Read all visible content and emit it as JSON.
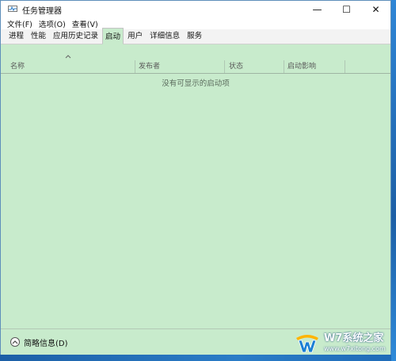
{
  "window": {
    "title": "任务管理器",
    "controls": {
      "minimize": "—",
      "maximize": "☐",
      "close": "✕"
    }
  },
  "menu": [
    "文件(F)",
    "选项(O)",
    "查看(V)"
  ],
  "tabs": [
    {
      "label": "进程",
      "active": false
    },
    {
      "label": "性能",
      "active": false
    },
    {
      "label": "应用历史记录",
      "active": false
    },
    {
      "label": "启动",
      "active": true
    },
    {
      "label": "用户",
      "active": false
    },
    {
      "label": "详细信息",
      "active": false
    },
    {
      "label": "服务",
      "active": false
    }
  ],
  "table": {
    "columns": [
      "名称",
      "发布者",
      "状态",
      "启动影响"
    ],
    "empty_message": "没有可显示的启动项"
  },
  "footer": {
    "label": "简略信息(D)"
  },
  "watermark": {
    "title": "W7系统之家",
    "url": "www.w7xitong.com"
  },
  "colors": {
    "content_bg": "#c8ebcc",
    "desktop_blue": "#1f6cb8"
  }
}
